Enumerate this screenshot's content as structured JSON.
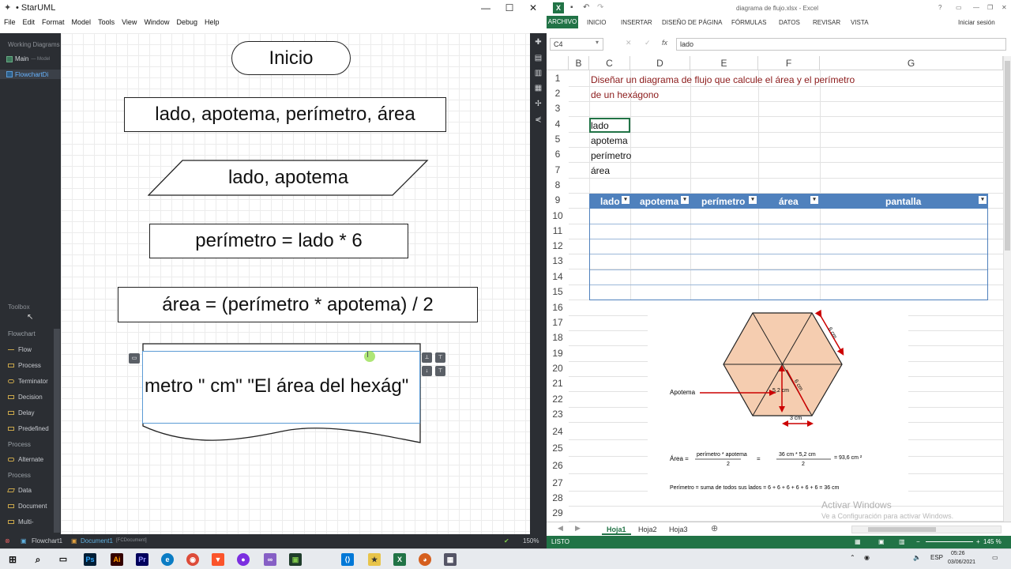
{
  "staruml": {
    "window_title": "• StarUML",
    "menu": [
      "File",
      "Edit",
      "Format",
      "Model",
      "Tools",
      "View",
      "Window",
      "Debug",
      "Help"
    ],
    "sidebar": {
      "working_diagrams_label": "Working Diagrams",
      "items": [
        {
          "label": "Main",
          "sub": "— Model"
        },
        {
          "label": "FlowchartDi"
        }
      ],
      "toolbox_label": "Toolbox",
      "flowchart_label": "Flowchart",
      "tools": [
        "Flow",
        "Process",
        "Terminator",
        "Decision",
        "Delay",
        "Predefined"
      ],
      "process_label_1": "Process",
      "tools2": [
        "Alternate"
      ],
      "process_label_2": "Process",
      "tools3": [
        "Data",
        "Document",
        "Multi-"
      ]
    },
    "diagram": {
      "start": "Inicio",
      "variables": "lado, apotema, perímetro, área",
      "input": "lado, apotema",
      "perimeter_formula": "perímetro = lado * 6",
      "area_formula": "área = (perímetro * apotema) / 2",
      "output_editing": "metro \" cm\" \"El área del hexág\""
    },
    "statusbar": {
      "breadcrumb1": "Flowchart1",
      "breadcrumb2": "Document1",
      "breadcrumb2_type": "[FCDocument]",
      "zoom": "150%"
    }
  },
  "excel": {
    "window_title": "diagrama de flujo.xlsx - Excel",
    "ribbon_tabs": [
      "ARCHIVO",
      "INICIO",
      "INSERTAR",
      "DISEÑO DE PÁGINA",
      "FÓRMULAS",
      "DATOS",
      "REVISAR",
      "VISTA"
    ],
    "sign_in": "Iniciar sesión",
    "name_box": "C4",
    "formula_value": "lado",
    "columns": [
      "B",
      "C",
      "D",
      "E",
      "F",
      "G"
    ],
    "rows": [
      "1",
      "2",
      "3",
      "4",
      "5",
      "6",
      "7",
      "8",
      "9",
      "10",
      "11",
      "12",
      "13",
      "14",
      "15",
      "16",
      "17",
      "18",
      "19",
      "20",
      "21",
      "22",
      "23",
      "24",
      "25",
      "26",
      "27",
      "28",
      "29"
    ],
    "cells": {
      "line1": "Diseñar un diagrama de flujo que calcule el área y el perímetro",
      "line2": "de un hexágono",
      "c4": "lado",
      "c5": "apotema",
      "c6": "perímetro",
      "c7": "área"
    },
    "table_headers": [
      "lado",
      "apotema",
      "perímetro",
      "área",
      "pantalla"
    ],
    "image": {
      "side_label": "6 cm",
      "apotema_label": "Apotema",
      "apotema_value": "5,2 cm",
      "radius_label": "6 cm",
      "half_side": "3 cm",
      "area_prefix": "Área =",
      "area_frac1_num": "perímetro * apotema",
      "area_frac1_den": "2",
      "eq": "=",
      "area_frac2_num": "36 cm * 5,2 cm",
      "area_frac2_den": "2",
      "area_result": "= 93,6 cm ²",
      "perimeter_line": "Perímetro = suma de todos sus lados = 6 + 6 + 6 + 6 + 6 + 6 = 36 cm"
    },
    "sheets": [
      "Hoja1",
      "Hoja2",
      "Hoja3"
    ],
    "status_text": "LISTO",
    "zoom": "145 %",
    "watermark": "Activar Windows",
    "watermark_sub": "Ve a Configuración para activar Windows."
  },
  "taskbar": {
    "language": "ESP",
    "time": "05:26",
    "date": "03/06/2021"
  },
  "colors": {
    "excel_green": "#217346",
    "table_blue": "#4f81bd",
    "hexagon_fill": "#f5cdb0",
    "red_text": "#8b1a1a",
    "staruml_dark": "#2b2e33"
  }
}
